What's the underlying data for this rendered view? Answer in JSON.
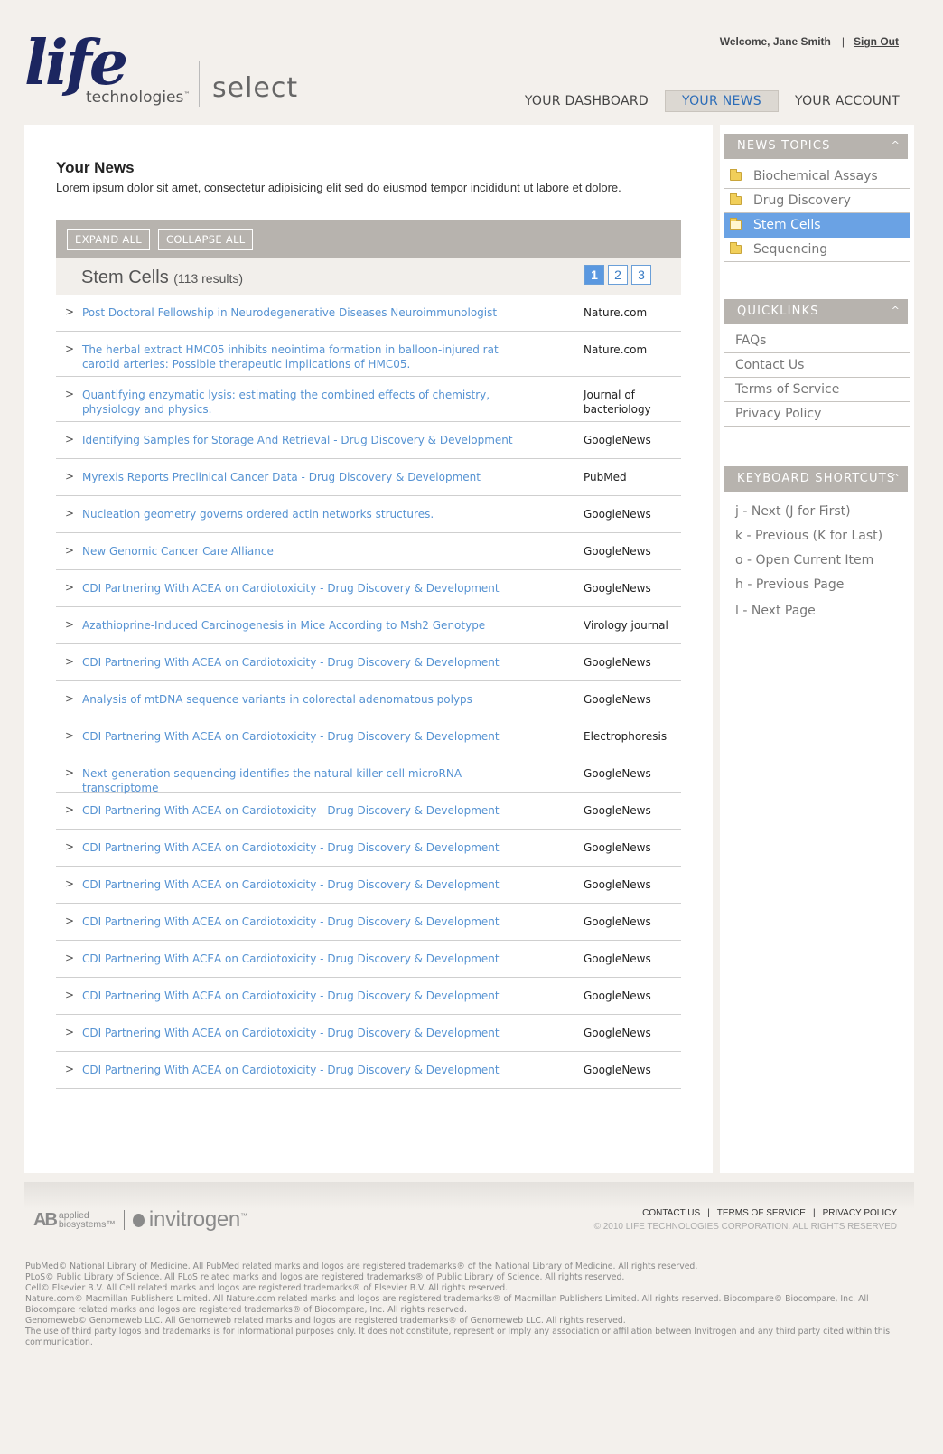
{
  "brand": {
    "life": "life",
    "technologies": "technologies",
    "tm": "™",
    "select": "select"
  },
  "user": {
    "welcome": "Welcome, Jane Smith",
    "separator": "|",
    "signout": "Sign Out"
  },
  "nav": {
    "dashboard": "YOUR DASHBOARD",
    "news": "YOUR NEWS",
    "account": "YOUR ACCOUNT",
    "active": "news"
  },
  "main": {
    "title": "Your News",
    "description": "Lorem ipsum dolor sit amet, consectetur adipisicing elit sed do eiusmod tempor incididunt ut labore et dolore.",
    "expand_all": "EXPAND ALL",
    "collapse_all": "COLLAPSE ALL",
    "topic": "Stem Cells",
    "count": "(113 results)",
    "pages": [
      "1",
      "2",
      "3"
    ],
    "current_page": "1",
    "arrow_glyph": ">",
    "items": [
      {
        "title": "Post Doctoral Fellowship in Neurodegenerative Diseases Neuroimmunologist",
        "source": "Nature.com"
      },
      {
        "title": "The herbal extract HMC05 inhibits neointima formation in balloon-injured rat carotid arteries: Possible therapeutic implications of HMC05.",
        "source": "Nature.com"
      },
      {
        "title": "Quantifying enzymatic lysis: estimating the combined effects of chemistry, physiology and physics.",
        "source": "Journal of bacteriology"
      },
      {
        "title": "Identifying Samples for Storage And Retrieval - Drug Discovery & Development",
        "source": "GoogleNews"
      },
      {
        "title": "Myrexis Reports Preclinical Cancer Data - Drug Discovery & Development",
        "source": "PubMed"
      },
      {
        "title": "Nucleation geometry governs ordered actin networks structures.",
        "source": "GoogleNews"
      },
      {
        "title": "New Genomic Cancer Care Alliance",
        "source": "GoogleNews"
      },
      {
        "title": "CDI Partnering With ACEA on Cardiotoxicity - Drug Discovery & Development",
        "source": "GoogleNews"
      },
      {
        "title": "Azathioprine-Induced Carcinogenesis in Mice According to Msh2 Genotype",
        "source": "Virology journal"
      },
      {
        "title": "CDI Partnering With ACEA on Cardiotoxicity - Drug Discovery & Development",
        "source": "GoogleNews"
      },
      {
        "title": "Analysis of mtDNA sequence variants in colorectal adenomatous polyps",
        "source": "GoogleNews"
      },
      {
        "title": "CDI Partnering With ACEA on Cardiotoxicity - Drug Discovery & Development",
        "source": "Electrophoresis"
      },
      {
        "title": "Next-generation sequencing identifies the natural killer cell microRNA transcriptome",
        "source": "GoogleNews"
      },
      {
        "title": "CDI Partnering With ACEA on Cardiotoxicity - Drug Discovery & Development",
        "source": "GoogleNews"
      },
      {
        "title": "CDI Partnering With ACEA on Cardiotoxicity - Drug Discovery & Development",
        "source": "GoogleNews"
      },
      {
        "title": "CDI Partnering With ACEA on Cardiotoxicity - Drug Discovery & Development",
        "source": "GoogleNews"
      },
      {
        "title": "CDI Partnering With ACEA on Cardiotoxicity - Drug Discovery & Development",
        "source": "GoogleNews"
      },
      {
        "title": "CDI Partnering With ACEA on Cardiotoxicity - Drug Discovery & Development",
        "source": "GoogleNews"
      },
      {
        "title": "CDI Partnering With ACEA on Cardiotoxicity - Drug Discovery & Development",
        "source": "GoogleNews"
      },
      {
        "title": "CDI Partnering With ACEA on Cardiotoxicity - Drug Discovery & Development",
        "source": "GoogleNews"
      },
      {
        "title": "CDI Partnering With ACEA on Cardiotoxicity - Drug Discovery & Development",
        "source": "GoogleNews"
      }
    ]
  },
  "sidebar": {
    "caret": "^",
    "topics_header": "NEWS TOPICS",
    "topics": [
      "Biochemical Assays",
      "Drug Discovery",
      "Stem Cells",
      "Sequencing"
    ],
    "active_topic": "Stem Cells",
    "quicklinks_header": "QUICKLINKS",
    "quicklinks": [
      "FAQs",
      "Contact Us",
      "Terms  of Service",
      "Privacy Policy"
    ],
    "shortcuts_header": "KEYBOARD SHORTCUTS",
    "shortcuts": [
      "j - Next (J for First)",
      "k - Previous (K for Last)",
      "o - Open Current Item",
      "h - Previous Page",
      "l - Next Page"
    ]
  },
  "footer": {
    "ab_mark": "AB",
    "ab_line1": "applied",
    "ab_line2": "biosystems",
    "ab_tm": "™",
    "invitrogen": "invitrogen",
    "inv_tm": "™",
    "link_sep": "|",
    "contact": "CONTACT US",
    "terms": "TERMS OF SERVICE",
    "privacy": "PRIVACY POLICY",
    "copyright": "© 2010 LIFE TECHNOLOGIES CORPORATION. ALL RIGHTS RESERVED",
    "legal": [
      "PubMed© National Library of Medicine. All PubMed related marks and logos are registered trademarks® of the National Library of Medicine. All rights reserved.",
      "PLoS© Public Library of Science. All PLoS related marks and logos are registered trademarks® of Public Library of Science. All rights reserved.",
      "Cell© Elsevier B.V. All Cell related marks and logos are registered trademarks® of Elsevier B.V. All rights reserved.",
      "Nature.com© Macmillan Publishers Limited. All Nature.com related marks and logos are registered trademarks® of Macmillan Publishers Limited. All rights reserved. Biocompare© Biocompare, Inc. All Biocompare related marks and logos are registered trademarks® of Biocompare, Inc. All rights reserved.",
      "Genomeweb© Genomeweb LLC. All Genomeweb related marks and logos are registered trademarks® of Genomeweb LLC. All rights reserved.",
      "The use of third party logos and trademarks is for informational purposes only. It does not constitute, represent or imply any association or affiliation between Invitrogen and any third party cited within this communication."
    ]
  },
  "colors": {
    "link": "#5592d2",
    "active_nav": "#2b6cb8",
    "active_topic_bg": "#6aa2e4",
    "header_gray": "#b7b3ae",
    "brand_navy": "#1c2660"
  }
}
